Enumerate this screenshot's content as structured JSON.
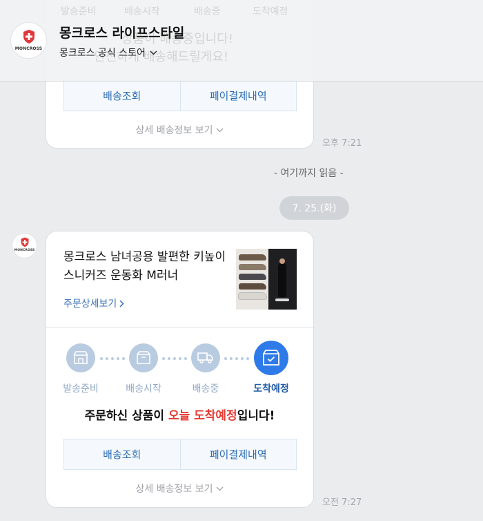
{
  "header": {
    "title": "몽크로스 라이프스타일",
    "subtitle": "몽크로스 공식 스토어",
    "logo_text": "MONCROSS"
  },
  "ghost": {
    "steps": [
      "발송준비",
      "배송시작",
      "배송중",
      "도착예정"
    ],
    "line1": "상품이 배송중입니다!",
    "line2": "안전하게 배송해드릴게요!"
  },
  "card1": {
    "buttons": {
      "track": "배송조회",
      "pay": "페이결제내역"
    },
    "detail": "상세 배송정보 보기",
    "time": "오후 7:21"
  },
  "read_divider": "- 여기까지 읽음 -",
  "date_pill": "7. 25.(화)",
  "card2": {
    "product_name": "몽크로스 남녀공용 발편한 키높이 스니커즈 운동화 M러너",
    "order_link": "주문상세보기",
    "steps": [
      {
        "label": "발송준비",
        "icon": "store-icon"
      },
      {
        "label": "배송시작",
        "icon": "box-icon"
      },
      {
        "label": "배송중",
        "icon": "truck-icon"
      },
      {
        "label": "도착예정",
        "icon": "delivered-box-icon"
      }
    ],
    "message_prefix": "주문하신 상품이 ",
    "message_highlight": "오늘 도착예정",
    "message_suffix": "입니다!",
    "buttons": {
      "track": "배송조회",
      "pay": "페이결제내역"
    },
    "detail": "상세 배송정보 보기",
    "time": "오전 7:27"
  },
  "colors": {
    "accent": "#2e7ae8",
    "link": "#2b6bb4",
    "highlight": "#e53b33",
    "inactive_step": "#b8cbe1"
  }
}
